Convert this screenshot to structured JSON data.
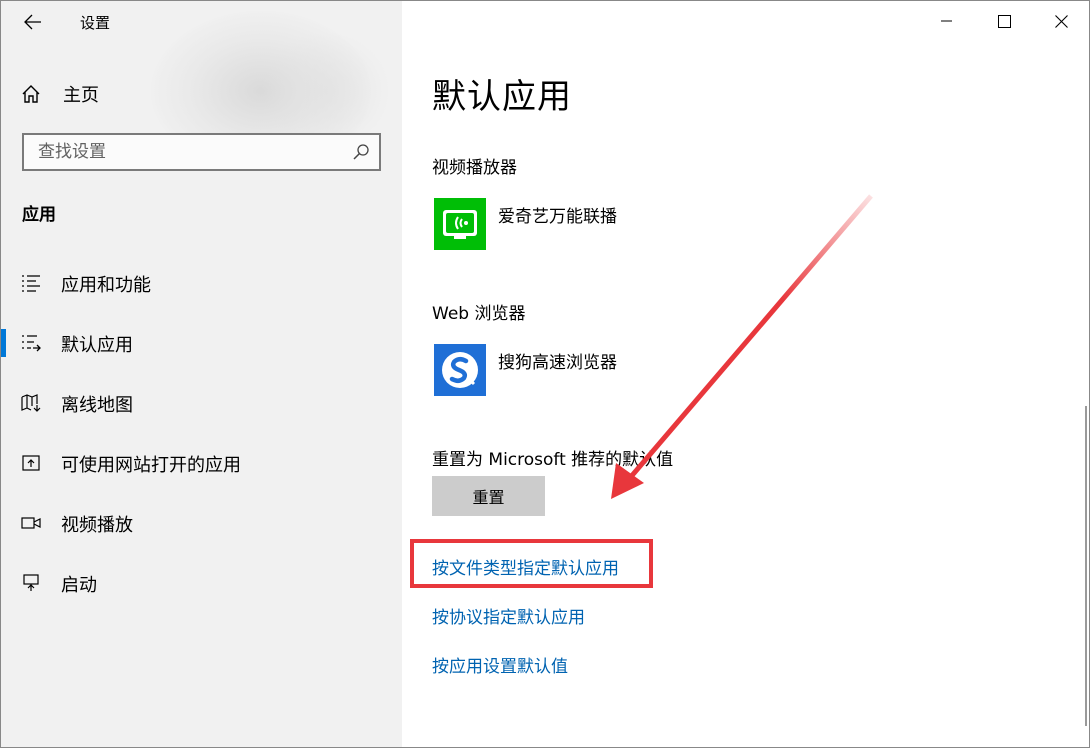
{
  "window": {
    "title": "设置"
  },
  "sidebar": {
    "home_label": "主页",
    "search_placeholder": "查找设置",
    "section_title": "应用",
    "items": [
      {
        "label": "应用和功能",
        "icon": "list-icon",
        "selected": false
      },
      {
        "label": "默认应用",
        "icon": "default-apps-icon",
        "selected": true
      },
      {
        "label": "离线地图",
        "icon": "map-download-icon",
        "selected": false
      },
      {
        "label": "可使用网站打开的应用",
        "icon": "open-website-icon",
        "selected": false
      },
      {
        "label": "视频播放",
        "icon": "video-camera-icon",
        "selected": false
      },
      {
        "label": "启动",
        "icon": "startup-icon",
        "selected": false
      }
    ]
  },
  "main": {
    "title": "默认应用",
    "video_player": {
      "label": "视频播放器",
      "app_name": "爱奇艺万能联播"
    },
    "web_browser": {
      "label": "Web 浏览器",
      "app_name": "搜狗高速浏览器"
    },
    "reset": {
      "label": "重置为 Microsoft 推荐的默认值",
      "button_label": "重置"
    },
    "links": [
      "按文件类型指定默认应用",
      "按协议指定默认应用",
      "按应用设置默认值"
    ]
  },
  "colors": {
    "accent": "#0078d7",
    "link": "#0063b1",
    "annotation_red": "#e8373c",
    "iqiyi_green": "#00be06",
    "sogou_blue": "#1f6fd6"
  }
}
